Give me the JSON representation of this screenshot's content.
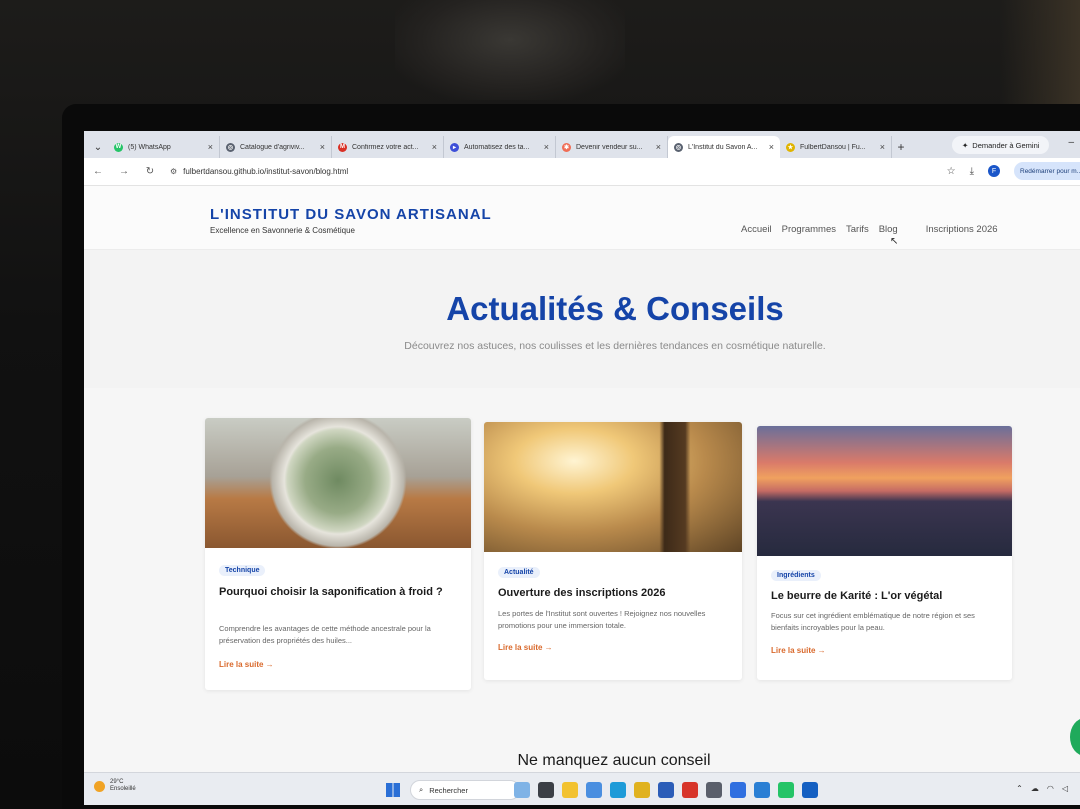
{
  "browser": {
    "tabs": [
      {
        "label": "(5) WhatsApp",
        "color": "#25c467",
        "glyph": "W"
      },
      {
        "label": "Catalogue d'agriviv...",
        "color": "#5a6270",
        "glyph": "◎"
      },
      {
        "label": "Confirmez votre act...",
        "color": "#d93025",
        "glyph": "M"
      },
      {
        "label": "Automatisez des ta...",
        "color": "#3d4fd8",
        "glyph": "▸"
      },
      {
        "label": "Devenir vendeur su...",
        "color": "#f06d55",
        "glyph": "✱"
      },
      {
        "label": "L'Institut du Savon A...",
        "color": "#5a6270",
        "glyph": "◎",
        "active": true
      },
      {
        "label": "FulbertDansou | Fu...",
        "color": "#e0b400",
        "glyph": "★"
      }
    ],
    "new_tab": "+",
    "gemini_label": "Demander à Gemini",
    "url": "fulbertdansou.github.io/institut-savon/blog.html",
    "resume_label": "Redémarrer pour m...",
    "profile_initial": "F"
  },
  "site": {
    "brand": "L'INSTITUT DU SAVON ARTISANAL",
    "tagline": "Excellence en Savonnerie & Cosmétique",
    "nav": [
      "Accueil",
      "Programmes",
      "Tarifs",
      "Blog"
    ],
    "nav_cta": "Inscriptions 2026"
  },
  "hero": {
    "title": "Actualités & Conseils",
    "subtitle": "Découvrez nos astuces, nos coulisses et les dernières tendances en cosmétique naturelle."
  },
  "posts": [
    {
      "tag": "Technique",
      "title": "Pourquoi choisir la saponification à froid ?",
      "excerpt": "Comprendre les avantages de cette méthode ancestrale pour la préservation des propriétés des huiles...",
      "link": "Lire la suite →"
    },
    {
      "tag": "Actualité",
      "title": "Ouverture des inscriptions 2026",
      "excerpt": "Les portes de l'Institut sont ouvertes ! Rejoignez nos nouvelles promotions pour une immersion totale.",
      "link": "Lire la suite →"
    },
    {
      "tag": "Ingrédients",
      "title": "Le beurre de Karité : L'or végétal",
      "excerpt": "Focus sur cet ingrédient emblématique de notre région et ses bienfaits incroyables pour la peau.",
      "link": "Lire la suite →"
    }
  ],
  "newsletter_heading": "Ne manquez aucun conseil",
  "taskbar": {
    "temperature": "29°C",
    "condition": "Ensoleillé",
    "search_placeholder": "Rechercher"
  }
}
